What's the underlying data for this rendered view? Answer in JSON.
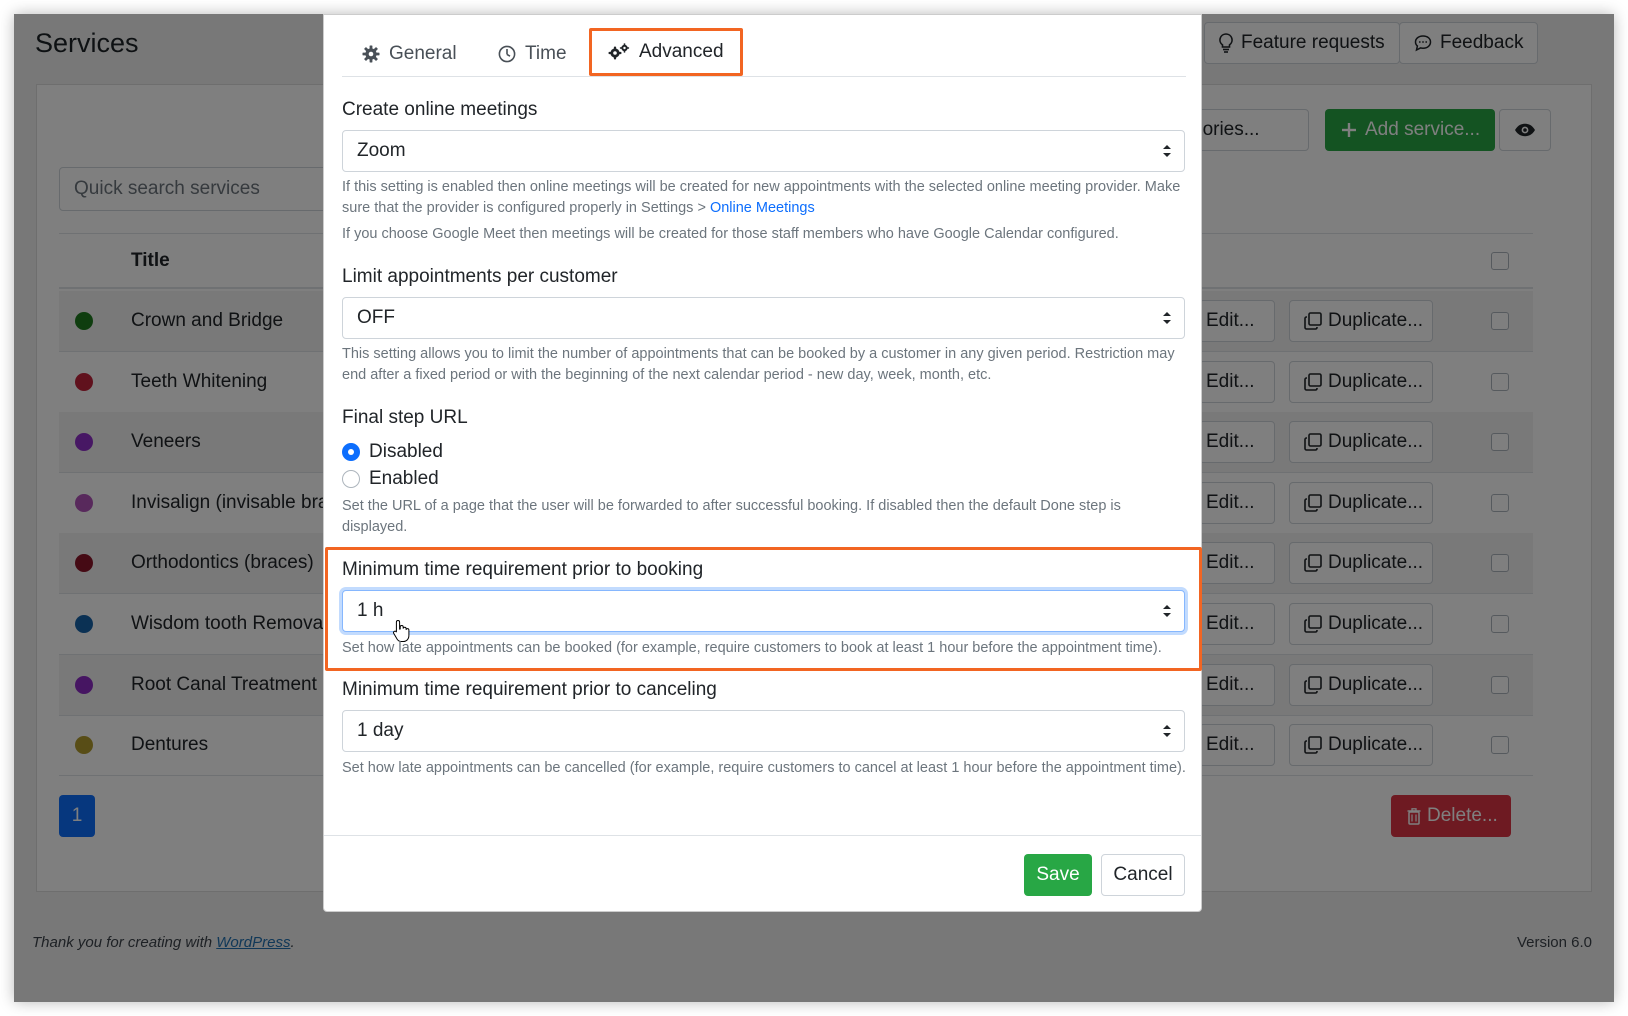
{
  "page": {
    "title": "Services"
  },
  "top_buttons": {
    "feature_requests": "Feature requests",
    "feedback": "Feedback"
  },
  "toolbar": {
    "categories_label": "gories...",
    "add_service_label": "Add service..."
  },
  "search": {
    "placeholder": "Quick search services"
  },
  "table": {
    "title_header": "Title",
    "rows": [
      {
        "name": "Crown and Bridge",
        "color": "#1e7b1e"
      },
      {
        "name": "Teeth Whitening",
        "color": "#c0233a"
      },
      {
        "name": "Veneers",
        "color": "#8e2fc9"
      },
      {
        "name": "Invisalign (invisable brac",
        "color": "#b052b8"
      },
      {
        "name": "Orthodontics (braces)",
        "color": "#8b1428"
      },
      {
        "name": "Wisdom tooth Removal",
        "color": "#1662a8"
      },
      {
        "name": "Root Canal Treatment",
        "color": "#8c2bc4"
      },
      {
        "name": "Dentures",
        "color": "#b09a2c"
      }
    ],
    "edit_label": "Edit...",
    "duplicate_label": "Duplicate..."
  },
  "pagination": {
    "current": "1"
  },
  "delete_label": "Delete...",
  "footer": {
    "thanks_prefix": "Thank you for creating with ",
    "thanks_link": "WordPress",
    "thanks_suffix": ".",
    "version": "Version 6.0"
  },
  "modal": {
    "tabs": [
      {
        "label": "General",
        "icon": "gear-icon"
      },
      {
        "label": "Time",
        "icon": "clock-icon"
      },
      {
        "label": "Advanced",
        "icon": "gears-icon",
        "active": true
      }
    ],
    "online_meetings": {
      "label": "Create online meetings",
      "value": "Zoom",
      "help_1": "If this setting is enabled then online meetings will be created for new appointments with the selected online meeting provider. Make sure that the provider is configured properly in Settings > ",
      "help_link": "Online Meetings",
      "help_2": "If you choose Google Meet then meetings will be created for those staff members who have Google Calendar configured."
    },
    "limit_appointments": {
      "label": "Limit appointments per customer",
      "value": "OFF",
      "help": "This setting allows you to limit the number of appointments that can be booked by a customer in any given period. Restriction may end after a fixed period or with the beginning of the next calendar period - new day, week, month, etc."
    },
    "final_step_url": {
      "label": "Final step URL",
      "options": [
        "Disabled",
        "Enabled"
      ],
      "selected": "Disabled",
      "help": "Set the URL of a page that the user will be forwarded to after successful booking. If disabled then the default Done step is displayed."
    },
    "min_time_booking": {
      "label": "Minimum time requirement prior to booking",
      "value": "1 h",
      "help": "Set how late appointments can be booked (for example, require customers to book at least 1 hour before the appointment time)."
    },
    "min_time_canceling": {
      "label": "Minimum time requirement prior to canceling",
      "value": "1 day",
      "help": "Set how late appointments can be cancelled (for example, require customers to cancel at least 1 hour before the appointment time)."
    },
    "save_label": "Save",
    "cancel_label": "Cancel"
  },
  "colors": {
    "accent_highlight": "#f26522",
    "primary": "#0d6efd",
    "success": "#28a745",
    "danger": "#dc3545"
  }
}
